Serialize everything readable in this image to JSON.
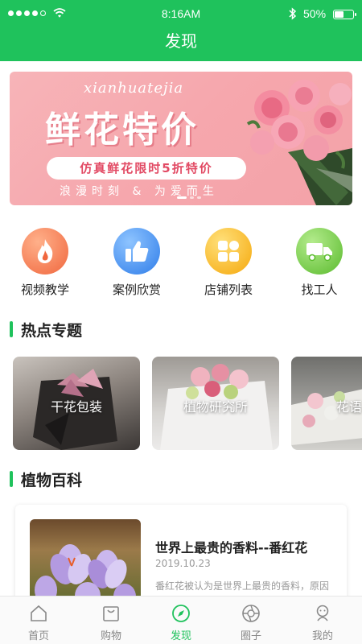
{
  "status_bar": {
    "time": "8:16AM",
    "battery": "50%",
    "battery_level": 0.5
  },
  "header": {
    "title": "发现"
  },
  "banner": {
    "script_text": "xianhuatejia",
    "headline": "鲜花特价",
    "pill_text": "仿真鲜花限时5折特价",
    "tagline": "浪漫时刻 & 为爱而生"
  },
  "categories": [
    {
      "label": "视频教学",
      "icon": "flame-icon",
      "color": "#f3784e"
    },
    {
      "label": "案例欣赏",
      "icon": "thumbs-up-icon",
      "color": "#3b8ef0"
    },
    {
      "label": "店铺列表",
      "icon": "store-grid-icon",
      "color": "#f7b21a"
    },
    {
      "label": "找工人",
      "icon": "truck-icon",
      "color": "#6cc63e"
    }
  ],
  "sections": {
    "hot_topics": {
      "title": "热点专题"
    },
    "plant_encyclopedia": {
      "title": "植物百科"
    }
  },
  "topics": [
    {
      "caption": "干花包装"
    },
    {
      "caption": "植物研究所"
    },
    {
      "caption": "花语"
    }
  ],
  "article": {
    "title": "世界上最贵的香料--番红花",
    "date": "2019.10.23",
    "summary": "番红花被认为是世界上最贵的香料，原因"
  },
  "tabbar": {
    "active": "发现",
    "items": [
      {
        "label": "首页",
        "icon": "home-icon"
      },
      {
        "label": "购物",
        "icon": "shopping-bag-icon"
      },
      {
        "label": "发现",
        "icon": "compass-icon"
      },
      {
        "label": "圈子",
        "icon": "aperture-icon"
      },
      {
        "label": "我的",
        "icon": "user-icon"
      }
    ]
  },
  "colors": {
    "brand": "#1fc25c",
    "banner_pink": "#f6a7ad",
    "pill_text": "#e24a64"
  }
}
